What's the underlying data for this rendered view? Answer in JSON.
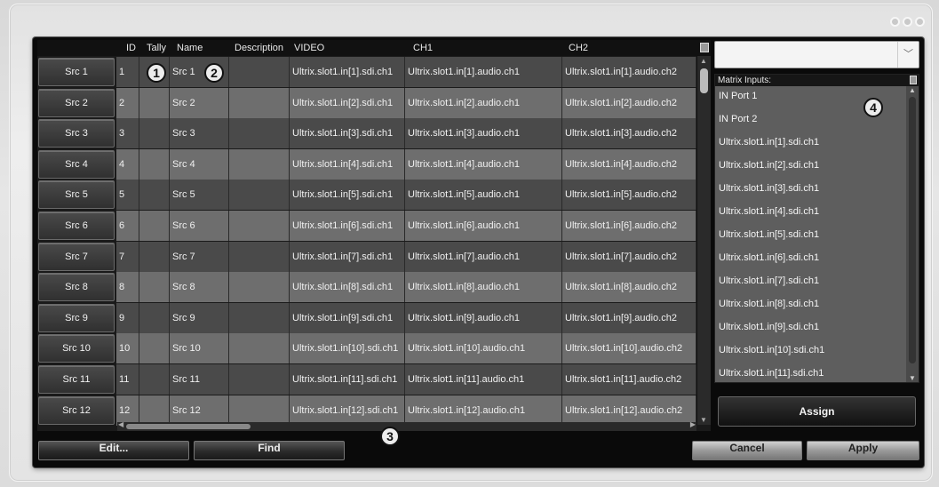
{
  "window": {
    "controls": [
      "dot",
      "dot",
      "dot"
    ]
  },
  "grid": {
    "columns": [
      "ID",
      "Tally",
      "Name",
      "Description",
      "VIDEO",
      "CH1",
      "CH2"
    ],
    "rows": [
      {
        "button": "Src 1",
        "id": "1",
        "tally": "",
        "name": "Src 1",
        "description": "",
        "video": "Ultrix.slot1.in[1].sdi.ch1",
        "ch1": "Ultrix.slot1.in[1].audio.ch1",
        "ch2": "Ultrix.slot1.in[1].audio.ch2"
      },
      {
        "button": "Src 2",
        "id": "2",
        "tally": "",
        "name": "Src 2",
        "description": "",
        "video": "Ultrix.slot1.in[2].sdi.ch1",
        "ch1": "Ultrix.slot1.in[2].audio.ch1",
        "ch2": "Ultrix.slot1.in[2].audio.ch2"
      },
      {
        "button": "Src 3",
        "id": "3",
        "tally": "",
        "name": "Src 3",
        "description": "",
        "video": "Ultrix.slot1.in[3].sdi.ch1",
        "ch1": "Ultrix.slot1.in[3].audio.ch1",
        "ch2": "Ultrix.slot1.in[3].audio.ch2"
      },
      {
        "button": "Src 4",
        "id": "4",
        "tally": "",
        "name": "Src 4",
        "description": "",
        "video": "Ultrix.slot1.in[4].sdi.ch1",
        "ch1": "Ultrix.slot1.in[4].audio.ch1",
        "ch2": "Ultrix.slot1.in[4].audio.ch2"
      },
      {
        "button": "Src 5",
        "id": "5",
        "tally": "",
        "name": "Src 5",
        "description": "",
        "video": "Ultrix.slot1.in[5].sdi.ch1",
        "ch1": "Ultrix.slot1.in[5].audio.ch1",
        "ch2": "Ultrix.slot1.in[5].audio.ch2"
      },
      {
        "button": "Src 6",
        "id": "6",
        "tally": "",
        "name": "Src 6",
        "description": "",
        "video": "Ultrix.slot1.in[6].sdi.ch1",
        "ch1": "Ultrix.slot1.in[6].audio.ch1",
        "ch2": "Ultrix.slot1.in[6].audio.ch2"
      },
      {
        "button": "Src 7",
        "id": "7",
        "tally": "",
        "name": "Src 7",
        "description": "",
        "video": "Ultrix.slot1.in[7].sdi.ch1",
        "ch1": "Ultrix.slot1.in[7].audio.ch1",
        "ch2": "Ultrix.slot1.in[7].audio.ch2"
      },
      {
        "button": "Src 8",
        "id": "8",
        "tally": "",
        "name": "Src 8",
        "description": "",
        "video": "Ultrix.slot1.in[8].sdi.ch1",
        "ch1": "Ultrix.slot1.in[8].audio.ch1",
        "ch2": "Ultrix.slot1.in[8].audio.ch2"
      },
      {
        "button": "Src 9",
        "id": "9",
        "tally": "",
        "name": "Src 9",
        "description": "",
        "video": "Ultrix.slot1.in[9].sdi.ch1",
        "ch1": "Ultrix.slot1.in[9].audio.ch1",
        "ch2": "Ultrix.slot1.in[9].audio.ch2"
      },
      {
        "button": "Src 10",
        "id": "10",
        "tally": "",
        "name": "Src 10",
        "description": "",
        "video": "Ultrix.slot1.in[10].sdi.ch1",
        "ch1": "Ultrix.slot1.in[10].audio.ch1",
        "ch2": "Ultrix.slot1.in[10].audio.ch2"
      },
      {
        "button": "Src 11",
        "id": "11",
        "tally": "",
        "name": "Src 11",
        "description": "",
        "video": "Ultrix.slot1.in[11].sdi.ch1",
        "ch1": "Ultrix.slot1.in[11].audio.ch1",
        "ch2": "Ultrix.slot1.in[11].audio.ch2"
      },
      {
        "button": "Src 12",
        "id": "12",
        "tally": "",
        "name": "Src 12",
        "description": "",
        "video": "Ultrix.slot1.in[12].sdi.ch1",
        "ch1": "Ultrix.slot1.in[12].audio.ch1",
        "ch2": "Ultrix.slot1.in[12].audio.ch2"
      }
    ]
  },
  "callouts": [
    "1",
    "2",
    "3",
    "4"
  ],
  "dropdown": {
    "value": "",
    "icon": "chevron-down-icon"
  },
  "matrix_inputs": {
    "title": "Matrix Inputs:",
    "items": [
      "IN Port 1",
      "IN Port 2",
      "Ultrix.slot1.in[1].sdi.ch1",
      "Ultrix.slot1.in[2].sdi.ch1",
      "Ultrix.slot1.in[3].sdi.ch1",
      "Ultrix.slot1.in[4].sdi.ch1",
      "Ultrix.slot1.in[5].sdi.ch1",
      "Ultrix.slot1.in[6].sdi.ch1",
      "Ultrix.slot1.in[7].sdi.ch1",
      "Ultrix.slot1.in[8].sdi.ch1",
      "Ultrix.slot1.in[9].sdi.ch1",
      "Ultrix.slot1.in[10].sdi.ch1",
      "Ultrix.slot1.in[11].sdi.ch1"
    ]
  },
  "buttons": {
    "assign": "Assign",
    "edit": "Edit...",
    "find": "Find",
    "cancel": "Cancel",
    "apply": "Apply"
  },
  "colors": {
    "row_odd": "#4a4a4a",
    "row_even": "#6e6e6e",
    "panel_bg": "#0a0a0a"
  }
}
